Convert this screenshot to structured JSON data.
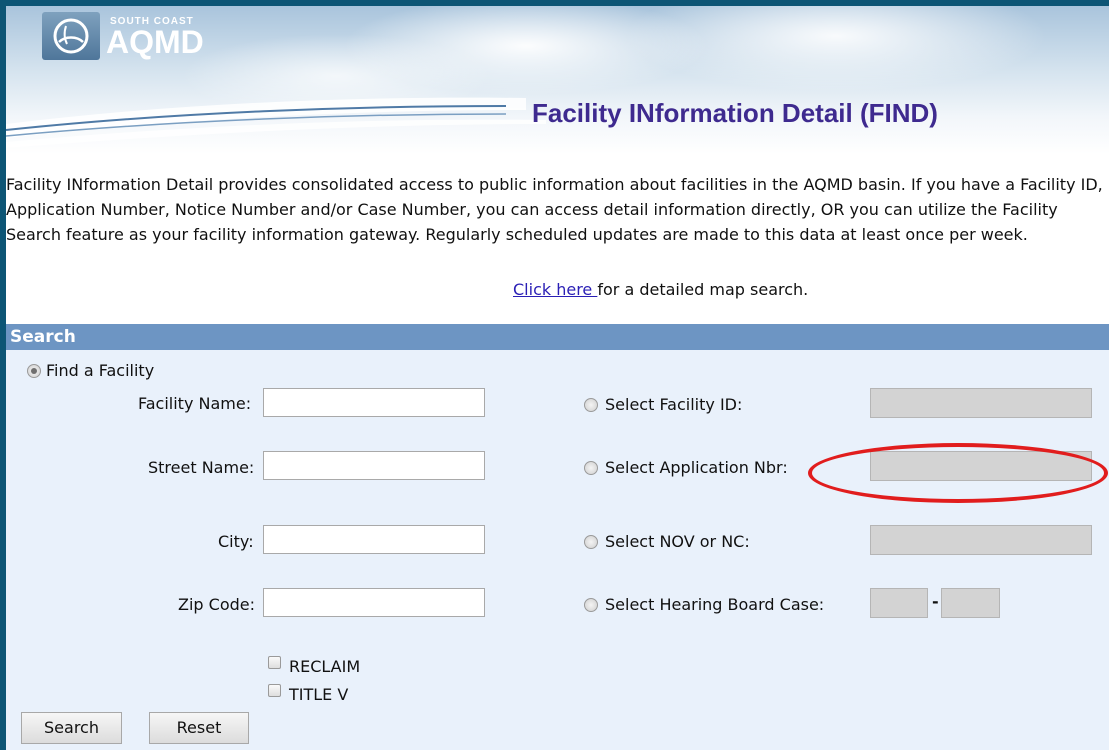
{
  "header": {
    "logo_small": "SOUTH COAST",
    "logo_big": "AQMD",
    "title": "Facility INformation Detail (FIND)"
  },
  "intro": {
    "text": "Facility INformation Detail provides consolidated access to public information about facilities in the AQMD basin. If you have a Facility ID, Application Number, Notice Number and/or Case Number, you can access detail information directly, OR you can utilize the Facility Search feature as your facility information gateway.  Regularly scheduled updates are made to this data at least once per week.",
    "map_link_text": "Click here ",
    "map_link_suffix": "for a detailed map search."
  },
  "search": {
    "header": "Search",
    "find_facility_label": "Find a Facility",
    "facility_name_label": "Facility Name:",
    "street_name_label": "Street Name:",
    "city_label": "City:",
    "zip_code_label": "Zip Code:",
    "reclaim_label": "RECLAIM",
    "title_v_label": "TITLE V",
    "select_facility_id_label": "Select Facility ID:",
    "select_application_label": "Select Application Nbr:",
    "select_nov_label": "Select NOV or NC:",
    "select_hearing_label": "Select Hearing Board Case:",
    "hearing_separator": "-",
    "search_button": "Search",
    "reset_button": "Reset"
  },
  "colors": {
    "title": "#3e2a8f",
    "search_header_bg": "#6d95c3",
    "search_body_bg": "#e9f1fb",
    "highlight": "#e11d1d",
    "frame_border": "#0d5575"
  }
}
